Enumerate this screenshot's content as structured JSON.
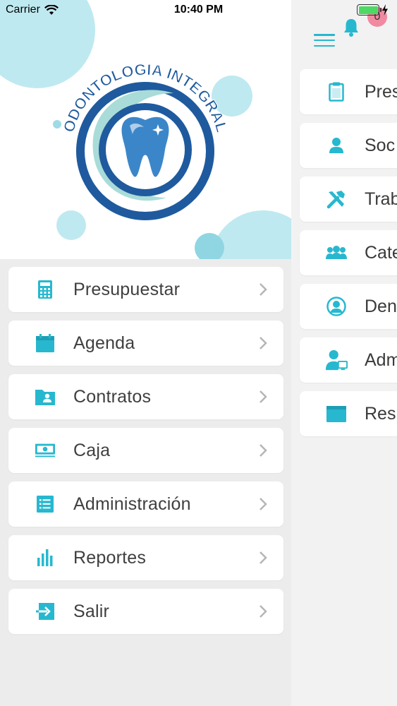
{
  "status_bar": {
    "carrier": "Carrier",
    "time": "10:40 PM",
    "battery_level": 1.0
  },
  "logo": {
    "text": "ODONTOLOGIA INTEGRAL",
    "colors": {
      "ring": "#1f5a9e",
      "swirl": "#a9dcd8",
      "tooth": "#3b86c9"
    }
  },
  "drawer_menu": {
    "items": [
      {
        "label": "Presupuestar",
        "icon": "calculator-icon"
      },
      {
        "label": "Agenda",
        "icon": "calendar-icon"
      },
      {
        "label": "Contratos",
        "icon": "folder-user-icon"
      },
      {
        "label": "Caja",
        "icon": "cash-icon"
      },
      {
        "label": "Administración",
        "icon": "list-icon"
      },
      {
        "label": "Reportes",
        "icon": "bar-chart-icon"
      },
      {
        "label": "Salir",
        "icon": "exit-icon"
      }
    ]
  },
  "main": {
    "notification_count": "0",
    "items": [
      {
        "label": "Pres",
        "icon": "clipboard-icon"
      },
      {
        "label": "Soc",
        "icon": "person-icon"
      },
      {
        "label": "Trab",
        "icon": "tools-icon"
      },
      {
        "label": "Cate",
        "icon": "group-icon"
      },
      {
        "label": "Den",
        "icon": "user-circle-icon"
      },
      {
        "label": "Adm",
        "icon": "user-computer-icon"
      },
      {
        "label": "Res",
        "icon": "folder-icon"
      }
    ]
  },
  "colors": {
    "accent": "#27b8cf",
    "badge": "#f08aa0",
    "battery": "#4cd964"
  }
}
